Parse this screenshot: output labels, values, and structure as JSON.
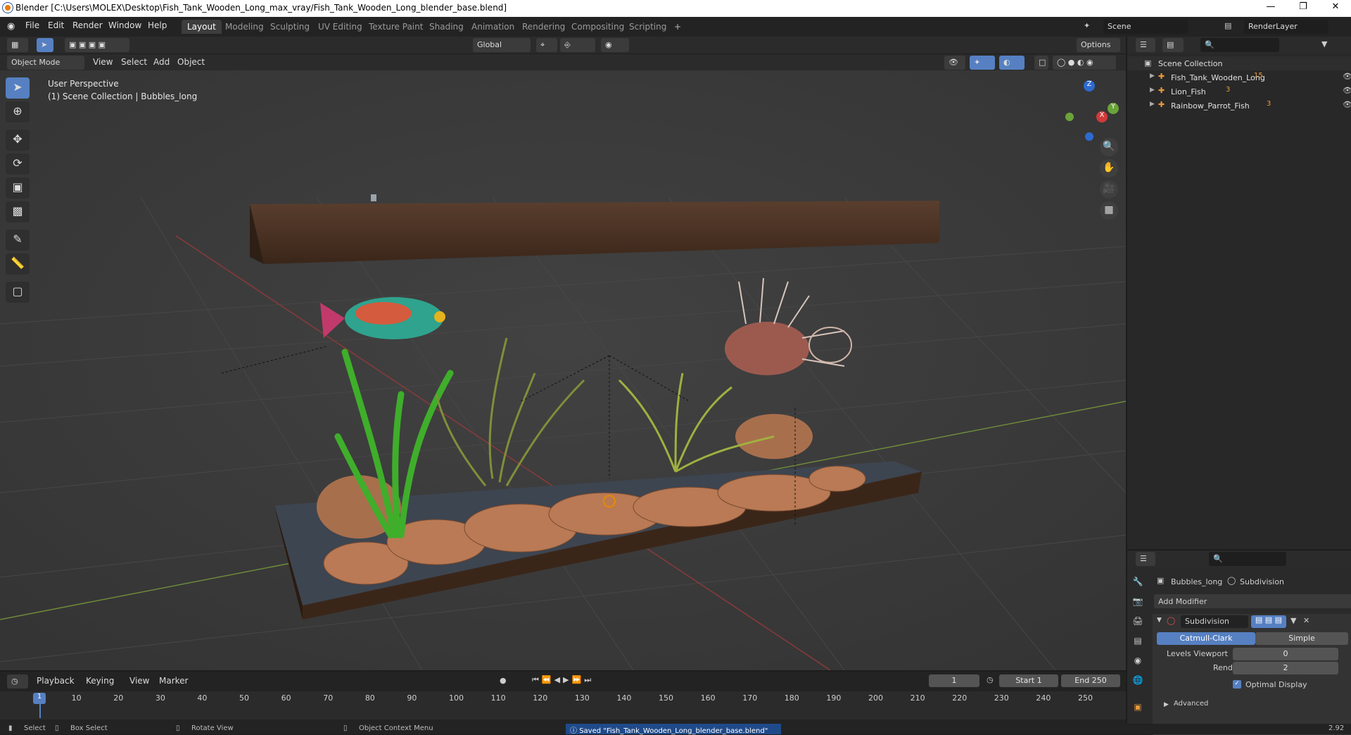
{
  "window": {
    "title": "Blender [C:\\Users\\MOLEX\\Desktop\\Fish_Tank_Wooden_Long_max_vray/Fish_Tank_Wooden_Long_blender_base.blend]",
    "controls": [
      "—",
      "❐",
      "✕"
    ]
  },
  "menu": {
    "items": [
      "File",
      "Edit",
      "Render",
      "Window",
      "Help"
    ]
  },
  "workspaces": [
    "Layout",
    "Modeling",
    "Sculpting",
    "UV Editing",
    "Texture Paint",
    "Shading",
    "Animation",
    "Rendering",
    "Compositing",
    "Scripting"
  ],
  "workspace_add": "+",
  "scene": {
    "name": "Scene",
    "view_layer": "RenderLayer"
  },
  "viewport_header": {
    "transform_orientation": "Global",
    "options": "Options",
    "mode": "Object Mode",
    "menus": [
      "View",
      "Select",
      "Add",
      "Object"
    ]
  },
  "viewport": {
    "perspective": "User Perspective",
    "collection_info": "(1) Scene Collection | Bubbles_long",
    "axes": {
      "z": "Z",
      "y": "Y",
      "x": "X"
    }
  },
  "outliner": {
    "root": "Scene Collection",
    "items": [
      {
        "name": "Fish_Tank_Wooden_Long",
        "badge": "15"
      },
      {
        "name": "Lion_Fish",
        "badge": "3"
      },
      {
        "name": "Rainbow_Parrot_Fish",
        "badge": "3"
      }
    ]
  },
  "properties": {
    "object_name": "Bubbles_long",
    "modifier_tab": "Subdivision",
    "add_modifier": "Add Modifier",
    "modifier": {
      "name": "Subdivision",
      "types": [
        "Catmull-Clark",
        "Simple"
      ],
      "active_type": "Catmull-Clark",
      "levels_viewport_label": "Levels Viewport",
      "levels_viewport": "0",
      "render_label": "Render",
      "render": "2",
      "optimal_display_label": "Optimal Display",
      "optimal_display": true,
      "advanced": "Advanced"
    }
  },
  "timeline": {
    "menus": [
      "Playback",
      "Keying",
      "View",
      "Marker"
    ],
    "current_frame": "1",
    "start_label": "Start",
    "start": "1",
    "end_label": "End",
    "end": "250",
    "ticks": [
      "1",
      "10",
      "20",
      "30",
      "40",
      "50",
      "60",
      "70",
      "80",
      "90",
      "100",
      "110",
      "120",
      "130",
      "140",
      "150",
      "160",
      "170",
      "180",
      "190",
      "200",
      "210",
      "220",
      "230",
      "240",
      "250"
    ]
  },
  "statusbar": {
    "select": "Select",
    "box_select": "Box Select",
    "rotate_view": "Rotate View",
    "context_menu": "Object Context Menu",
    "message": "Saved \"Fish_Tank_Wooden_Long_blender_base.blend\"",
    "version": "2.92"
  },
  "colors": {
    "accent": "#5680c2",
    "viewport_bg": "#393939",
    "wood": "#4a3326",
    "gravel": "#b97a55"
  }
}
